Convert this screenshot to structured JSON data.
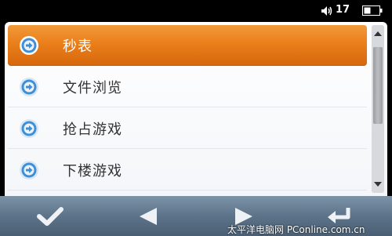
{
  "status": {
    "volume_level": "17"
  },
  "menu": {
    "items": [
      {
        "label": "秒表",
        "selected": true
      },
      {
        "label": "文件浏览",
        "selected": false
      },
      {
        "label": "抢占游戏",
        "selected": false
      },
      {
        "label": "下楼游戏",
        "selected": false
      }
    ]
  },
  "scrollbar": {
    "position_fraction": 0.0,
    "visible_fraction": 0.5
  },
  "toolbar": {
    "buttons": [
      "confirm-icon",
      "left-arrow-icon",
      "right-arrow-icon",
      "back-icon"
    ]
  },
  "watermark": "太平洋电脑网 PConline.com.cn",
  "colors": {
    "selected_accent": "#ea7f1b",
    "toolbar": "#5d7389",
    "icon_blue": "#3f8fd6"
  }
}
